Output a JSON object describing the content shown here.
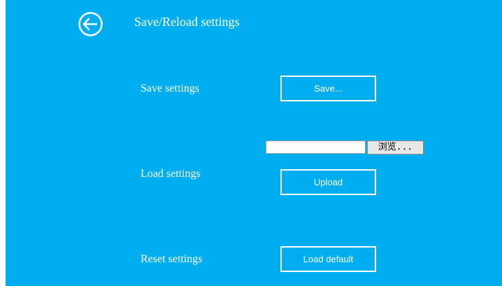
{
  "header": {
    "back_icon": "circle-arrow-left-icon",
    "title": "Save/Reload settings"
  },
  "save_section": {
    "label": "Save settings",
    "button_label": "Save..."
  },
  "load_section": {
    "label": "Load settings",
    "file_input_value": "",
    "browse_label": "浏览...",
    "button_label": "Upload"
  },
  "reset_section": {
    "label": "Reset settings",
    "button_label": "Load default"
  },
  "colors": {
    "background": "#00aeef",
    "foreground": "#ffffff",
    "browse_button": "#e7e7e7"
  }
}
